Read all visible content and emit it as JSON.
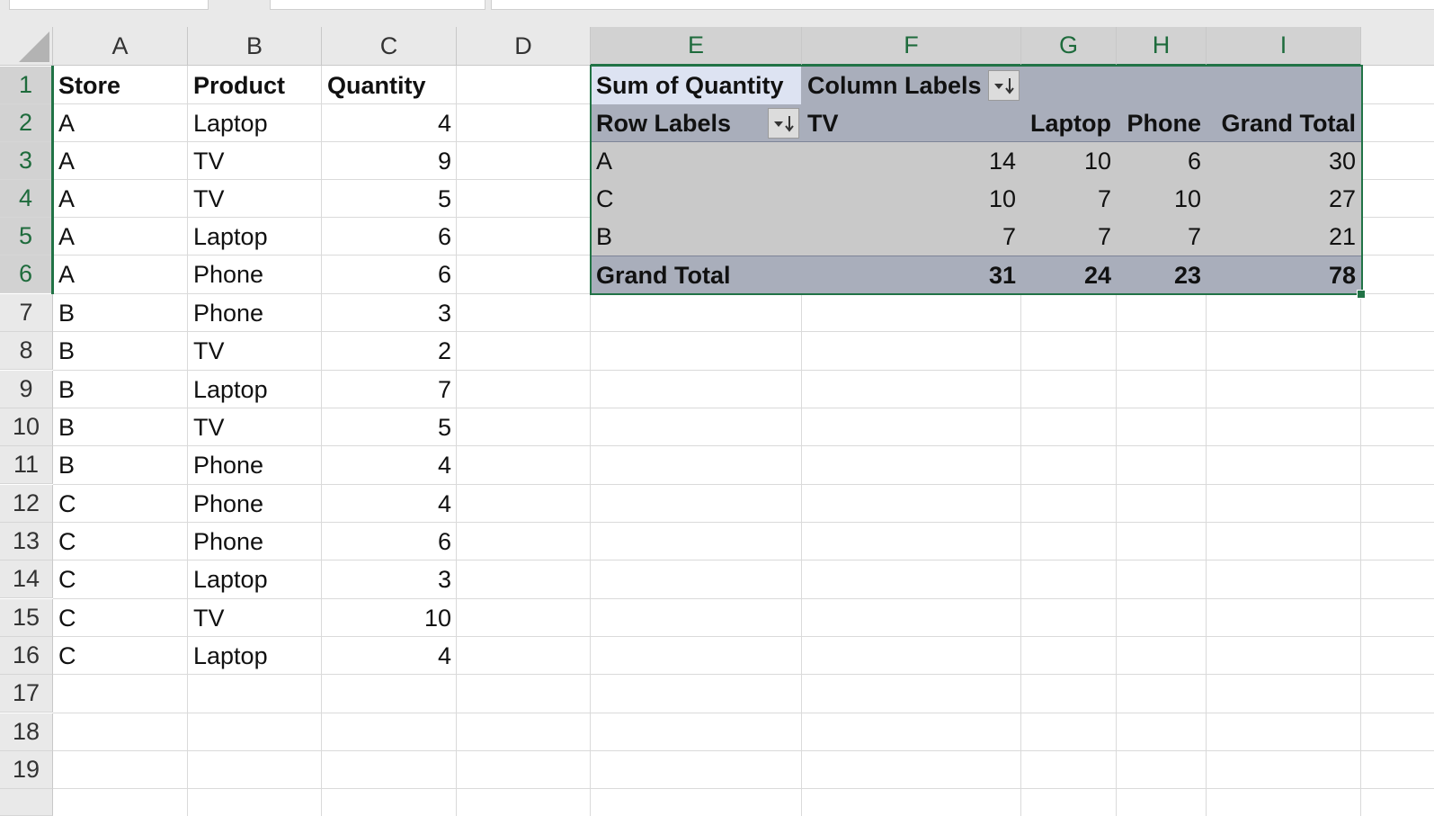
{
  "columns": [
    "A",
    "B",
    "C",
    "D",
    "E",
    "F",
    "G",
    "H",
    "I"
  ],
  "rows": [
    "1",
    "2",
    "3",
    "4",
    "5",
    "6",
    "7",
    "8",
    "9",
    "10",
    "11",
    "12",
    "13",
    "14",
    "15",
    "16",
    "17",
    "18",
    "19"
  ],
  "source_table": {
    "headers": [
      "Store",
      "Product",
      "Quantity"
    ],
    "records": [
      [
        "A",
        "Laptop",
        "4"
      ],
      [
        "A",
        "TV",
        "9"
      ],
      [
        "A",
        "TV",
        "5"
      ],
      [
        "A",
        "Laptop",
        "6"
      ],
      [
        "A",
        "Phone",
        "6"
      ],
      [
        "B",
        "Phone",
        "3"
      ],
      [
        "B",
        "TV",
        "2"
      ],
      [
        "B",
        "Laptop",
        "7"
      ],
      [
        "B",
        "TV",
        "5"
      ],
      [
        "B",
        "Phone",
        "4"
      ],
      [
        "C",
        "Phone",
        "4"
      ],
      [
        "C",
        "Phone",
        "6"
      ],
      [
        "C",
        "Laptop",
        "3"
      ],
      [
        "C",
        "TV",
        "10"
      ],
      [
        "C",
        "Laptop",
        "4"
      ]
    ]
  },
  "pivot": {
    "value_field": "Sum of Quantity",
    "column_labels": "Column Labels",
    "row_labels": "Row Labels",
    "columns": [
      "TV",
      "Laptop",
      "Phone",
      "Grand Total"
    ],
    "rows": [
      {
        "label": "A",
        "values": [
          "14",
          "10",
          "6",
          "30"
        ]
      },
      {
        "label": "C",
        "values": [
          "10",
          "7",
          "10",
          "27"
        ]
      },
      {
        "label": "B",
        "values": [
          "7",
          "7",
          "7",
          "21"
        ]
      }
    ],
    "grand_total": {
      "label": "Grand Total",
      "values": [
        "31",
        "24",
        "23",
        "78"
      ]
    }
  },
  "colors": {
    "selection": "#217346",
    "pivot_header": "#a9aebb",
    "pivot_body": "#c9c9c9"
  },
  "icons": {
    "filter_dropdown": "filter-sort-dropdown-icon"
  }
}
